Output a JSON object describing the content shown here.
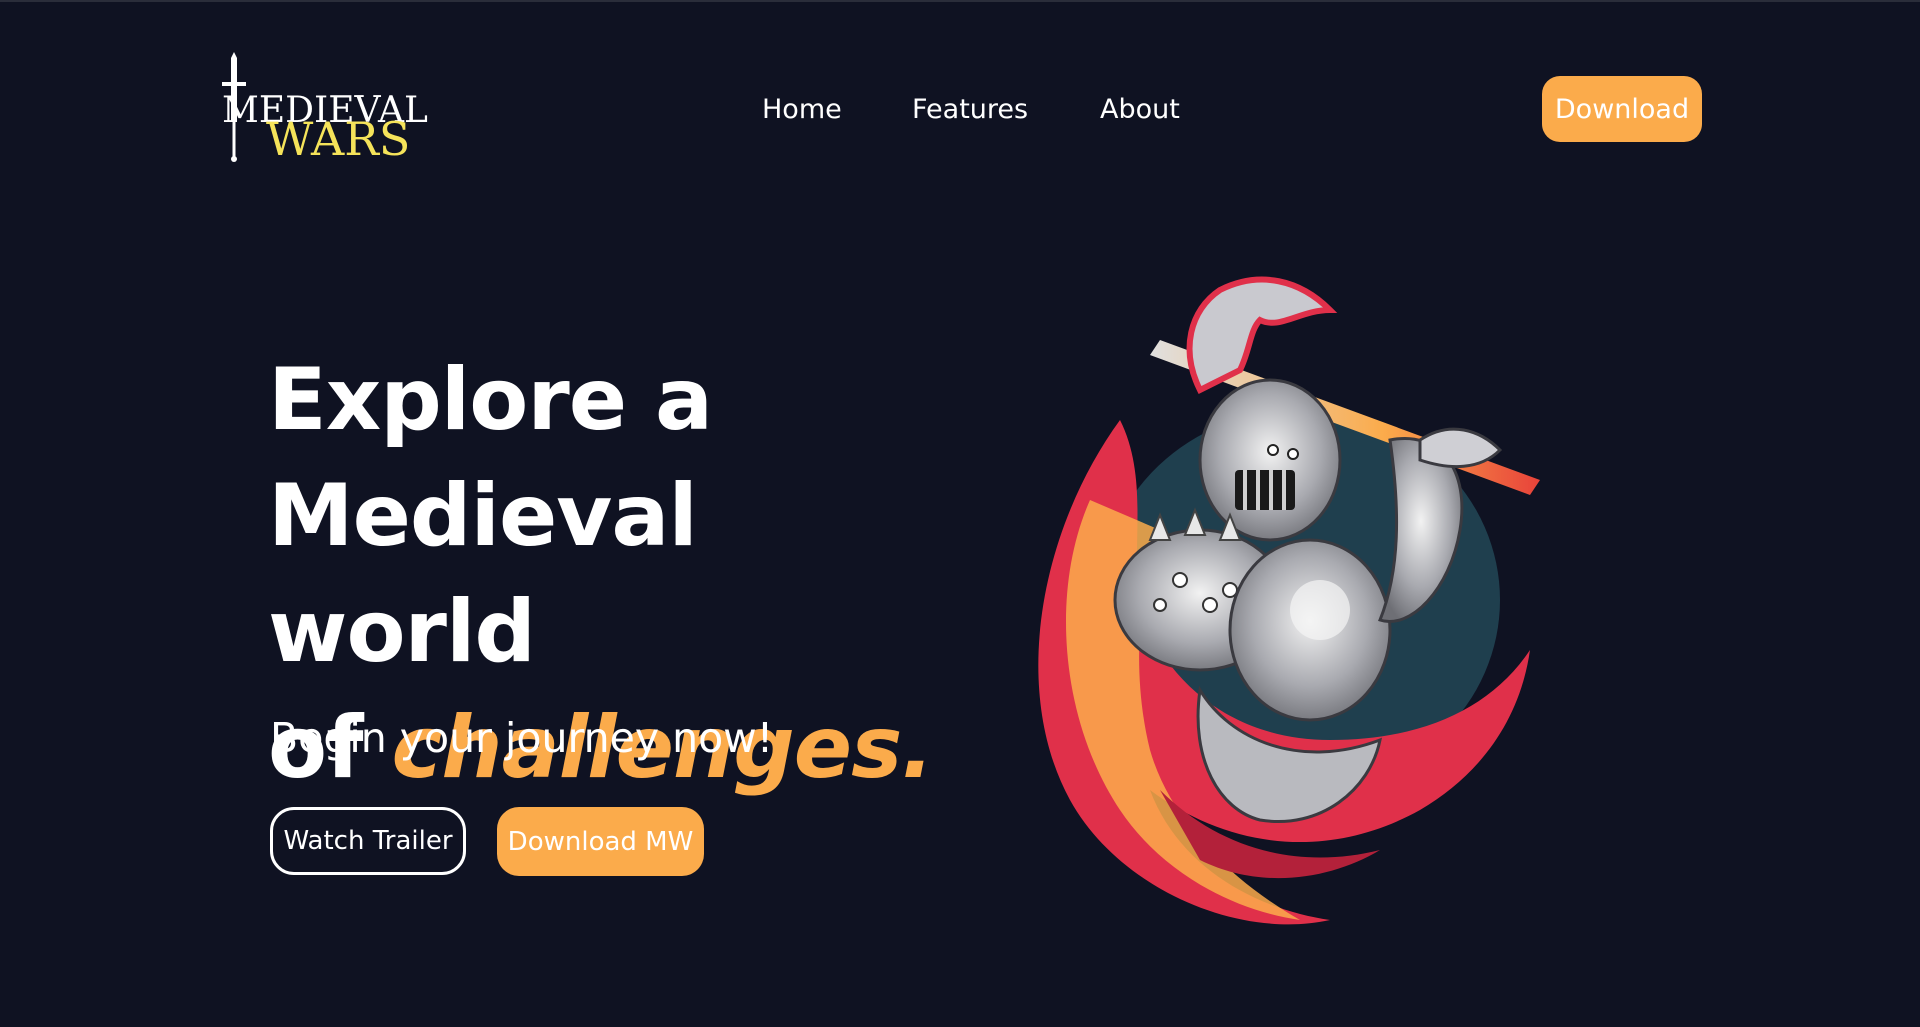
{
  "brand": {
    "word1": "MEDIEVAL",
    "word2": "WARS"
  },
  "nav": {
    "items": [
      {
        "label": "Home"
      },
      {
        "label": "Features"
      },
      {
        "label": "About"
      }
    ],
    "download_label": "Download"
  },
  "hero": {
    "title_line1": "Explore a",
    "title_line2": "Medieval world",
    "title_line3_prefix": "of",
    "title_accent": "challenges.",
    "subtitle": "Begin your journey now!",
    "watch_trailer_label": "Watch Trailer",
    "download_mw_label": "Download MW"
  },
  "colors": {
    "background": "#0f1222",
    "accent": "#fbab4b",
    "logo_yellow": "#f5e35a",
    "text": "#ffffff"
  }
}
